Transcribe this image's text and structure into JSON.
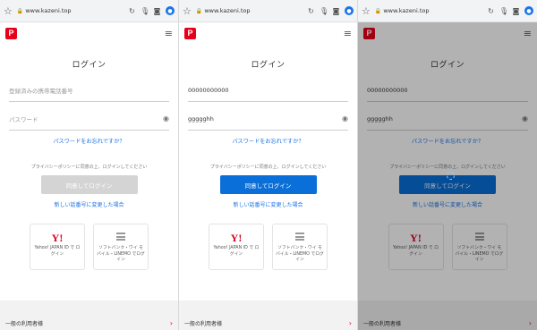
{
  "url": "www.kazeni.top",
  "logo_glyph": "P",
  "login_title": "ログイン",
  "phone_placeholder": "登録済みの携帯電話番号",
  "password_placeholder": "パスワード",
  "phone_value": "00000000000",
  "password_value": "ggggghh",
  "forgot_password": "パスワードをお忘れですか？",
  "privacy_notice": "プライバシーポリシーに同意の上、ログインしてください",
  "login_button": "同意してログイン",
  "number_changed": "新しい話番号に変更した場合",
  "number_changed_alt": "新しい話番号に変更した場合",
  "yahoo_logo": "Y!",
  "yahoo_label": "Yahoo! JAPAN ID で ログイン",
  "softbank_label": "ソフトバンク・ワイ モバイル・LINEMO でログイン",
  "footer_text": "一般の利用者様",
  "footer_arrow": "›",
  "colors": {
    "brand_red": "#e6001a",
    "button_blue": "#0a6fd8",
    "button_disabled": "#d4d4d4",
    "link_blue": "#1a73e8"
  },
  "panels": [
    {
      "state": "empty-fields",
      "button_state": "disabled"
    },
    {
      "state": "filled-fields",
      "button_state": "enabled"
    },
    {
      "state": "loading-dimmed",
      "button_state": "enabled"
    }
  ]
}
